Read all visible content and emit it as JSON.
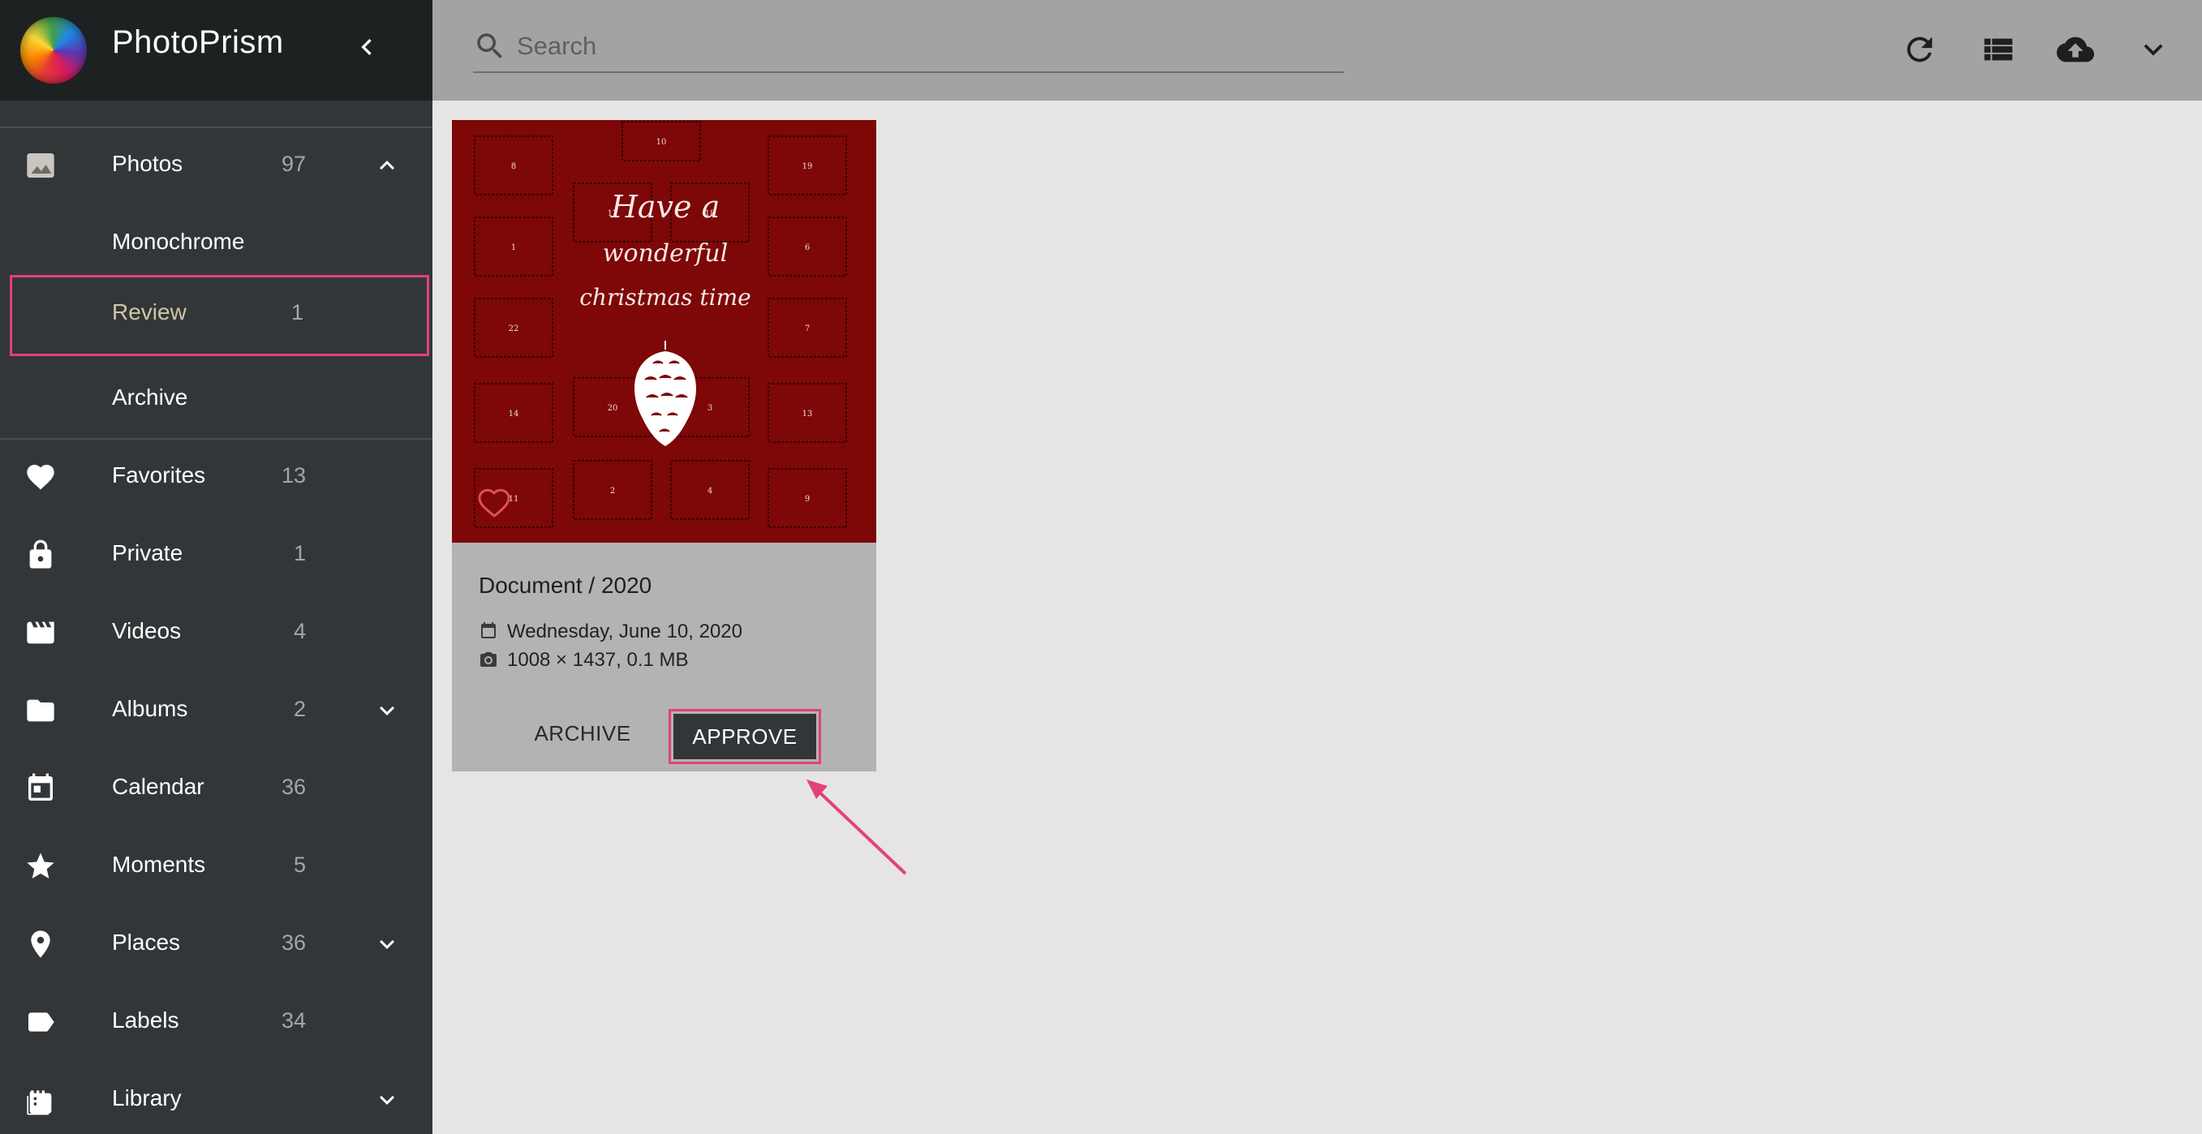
{
  "app": {
    "title": "PhotoPrism"
  },
  "search": {
    "placeholder": "Search"
  },
  "sidebar": {
    "items": [
      {
        "label": "Photos",
        "count": "97"
      },
      {
        "label": "Monochrome",
        "count": ""
      },
      {
        "label": "Review",
        "count": "1"
      },
      {
        "label": "Archive",
        "count": ""
      },
      {
        "label": "Favorites",
        "count": "13"
      },
      {
        "label": "Private",
        "count": "1"
      },
      {
        "label": "Videos",
        "count": "4"
      },
      {
        "label": "Albums",
        "count": "2"
      },
      {
        "label": "Calendar",
        "count": "36"
      },
      {
        "label": "Moments",
        "count": "5"
      },
      {
        "label": "Places",
        "count": "36"
      },
      {
        "label": "Labels",
        "count": "34"
      },
      {
        "label": "Library",
        "count": ""
      }
    ]
  },
  "toolbar": {
    "icons": [
      "refresh-icon",
      "view-list-icon",
      "cloud-upload-icon",
      "chevron-down-icon"
    ]
  },
  "card": {
    "title": "Document / 2020",
    "date": "Wednesday, June 10, 2020",
    "info": "1008 × 1437, 0.1 MB",
    "archive_label": "ARCHIVE",
    "approve_label": "APPROVE",
    "image_text": {
      "line1": "Have a",
      "line2": "wonderful",
      "line3": "christmas time",
      "numbers": [
        "10",
        "8",
        "19",
        "17",
        "18",
        "1",
        "6",
        "22",
        "7",
        "14",
        "20",
        "3",
        "13",
        "11",
        "2",
        "4",
        "9"
      ]
    }
  },
  "colors": {
    "sidebar_bg": "#333638",
    "brand_bg": "#1e2122",
    "topbar_bg": "#a3a3a3",
    "content_bg": "#e6e5e4",
    "highlight": "#e2427a",
    "photo_bg": "#7e0707"
  }
}
